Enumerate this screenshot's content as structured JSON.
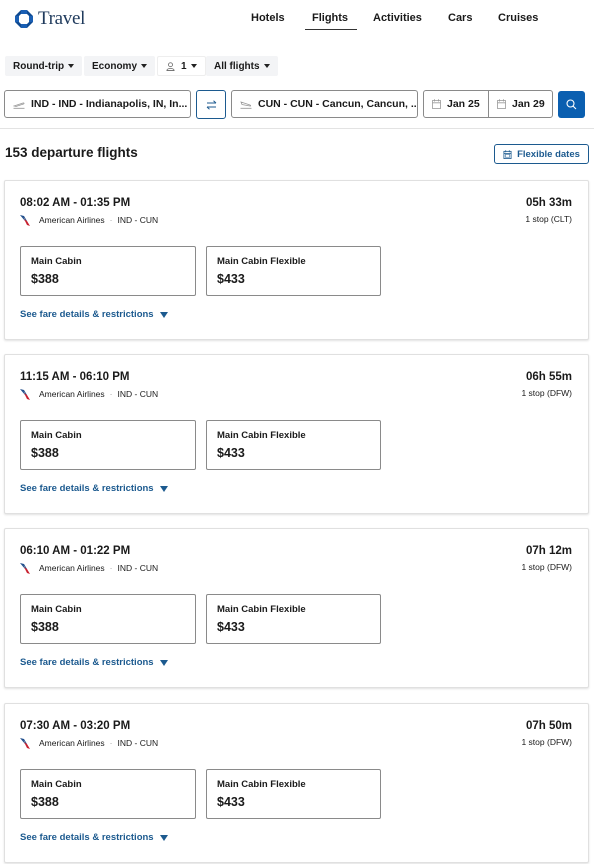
{
  "header": {
    "brand": "Travel",
    "brand_color": "#1f3a5c",
    "nav": [
      {
        "label": "Hotels",
        "active": false
      },
      {
        "label": "Flights",
        "active": true
      },
      {
        "label": "Activities",
        "active": false
      },
      {
        "label": "Cars",
        "active": false
      },
      {
        "label": "Cruises",
        "active": false
      }
    ]
  },
  "filters": {
    "trip_type": "Round-trip",
    "cabin": "Economy",
    "travelers": "1",
    "flight_type": "All flights"
  },
  "search": {
    "origin": "IND - IND - Indianapolis, IN, In...",
    "destination": "CUN - CUN - Cancun, Cancun, ...",
    "depart_date": "Jan 25",
    "return_date": "Jan 29",
    "accent_color": "#0b5fb0"
  },
  "results": {
    "title": "153 departure flights",
    "flexible_dates_label": "Flexible dates",
    "fare_link_label": "See fare details & restrictions",
    "flights": [
      {
        "time": "08:02 AM - 01:35 PM",
        "airline": "American Airlines",
        "route": "IND - CUN",
        "duration": "05h 33m",
        "stops": "1 stop (CLT)",
        "fares": [
          {
            "name": "Main Cabin",
            "price": "$388"
          },
          {
            "name": "Main Cabin Flexible",
            "price": "$433"
          }
        ]
      },
      {
        "time": "11:15 AM - 06:10 PM",
        "airline": "American Airlines",
        "route": "IND - CUN",
        "duration": "06h 55m",
        "stops": "1 stop (DFW)",
        "fares": [
          {
            "name": "Main Cabin",
            "price": "$388"
          },
          {
            "name": "Main Cabin Flexible",
            "price": "$433"
          }
        ]
      },
      {
        "time": "06:10 AM - 01:22 PM",
        "airline": "American Airlines",
        "route": "IND - CUN",
        "duration": "07h 12m",
        "stops": "1 stop (DFW)",
        "fares": [
          {
            "name": "Main Cabin",
            "price": "$388"
          },
          {
            "name": "Main Cabin Flexible",
            "price": "$433"
          }
        ]
      },
      {
        "time": "07:30 AM - 03:20 PM",
        "airline": "American Airlines",
        "route": "IND - CUN",
        "duration": "07h 50m",
        "stops": "1 stop (DFW)",
        "fares": [
          {
            "name": "Main Cabin",
            "price": "$388"
          },
          {
            "name": "Main Cabin Flexible",
            "price": "$433"
          }
        ]
      }
    ]
  }
}
